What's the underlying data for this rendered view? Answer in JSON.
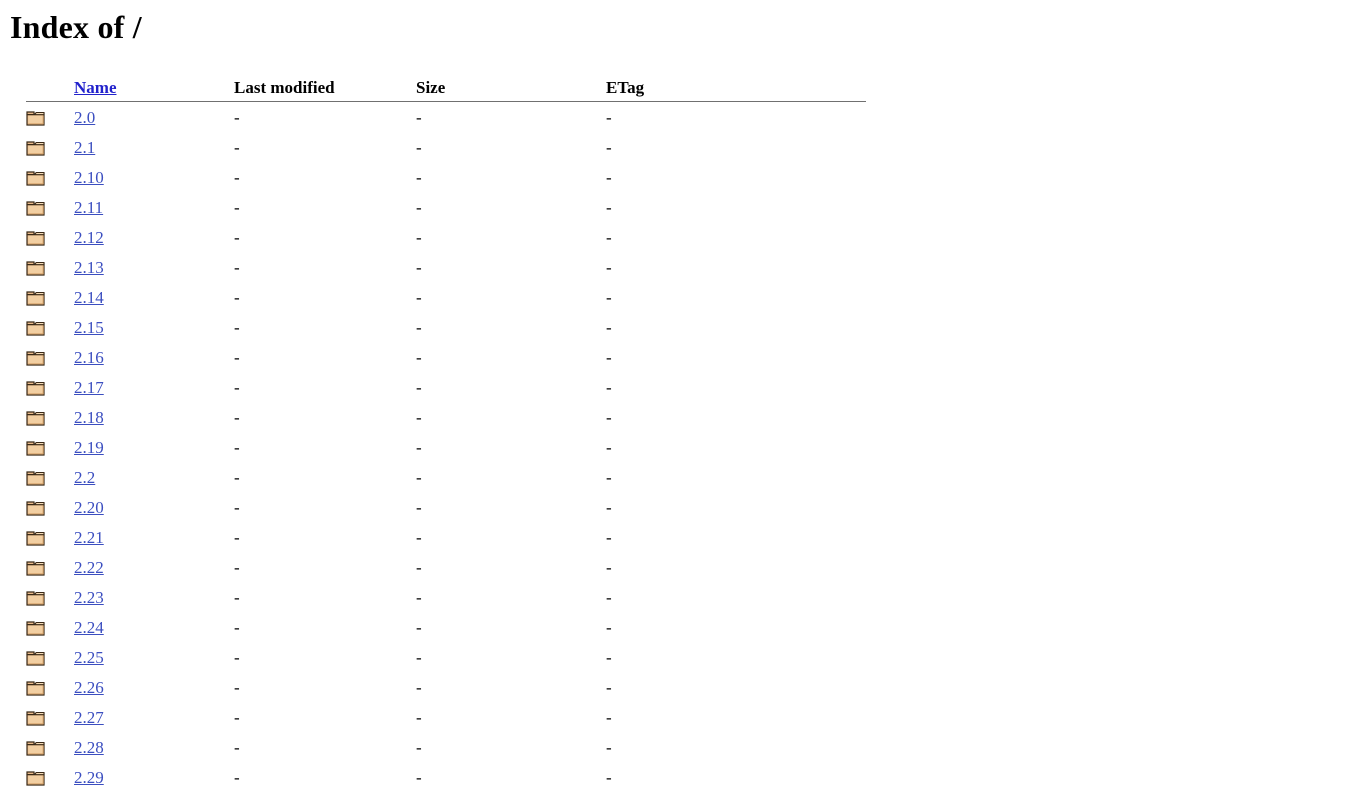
{
  "page": {
    "title": "Index of /"
  },
  "table": {
    "headers": {
      "icon": "",
      "name": "Name",
      "last_modified": "Last modified",
      "size": "Size",
      "etag": "ETag"
    },
    "placeholder_dash": "-",
    "icon_name": "folder-icon",
    "rows": [
      {
        "name": "2.0",
        "last_modified": "-",
        "size": "-",
        "etag": "-"
      },
      {
        "name": "2.1",
        "last_modified": "-",
        "size": "-",
        "etag": "-"
      },
      {
        "name": "2.10",
        "last_modified": "-",
        "size": "-",
        "etag": "-"
      },
      {
        "name": "2.11",
        "last_modified": "-",
        "size": "-",
        "etag": "-"
      },
      {
        "name": "2.12",
        "last_modified": "-",
        "size": "-",
        "etag": "-"
      },
      {
        "name": "2.13",
        "last_modified": "-",
        "size": "-",
        "etag": "-"
      },
      {
        "name": "2.14",
        "last_modified": "-",
        "size": "-",
        "etag": "-"
      },
      {
        "name": "2.15",
        "last_modified": "-",
        "size": "-",
        "etag": "-"
      },
      {
        "name": "2.16",
        "last_modified": "-",
        "size": "-",
        "etag": "-"
      },
      {
        "name": "2.17",
        "last_modified": "-",
        "size": "-",
        "etag": "-"
      },
      {
        "name": "2.18",
        "last_modified": "-",
        "size": "-",
        "etag": "-"
      },
      {
        "name": "2.19",
        "last_modified": "-",
        "size": "-",
        "etag": "-"
      },
      {
        "name": "2.2",
        "last_modified": "-",
        "size": "-",
        "etag": "-"
      },
      {
        "name": "2.20",
        "last_modified": "-",
        "size": "-",
        "etag": "-"
      },
      {
        "name": "2.21",
        "last_modified": "-",
        "size": "-",
        "etag": "-"
      },
      {
        "name": "2.22",
        "last_modified": "-",
        "size": "-",
        "etag": "-"
      },
      {
        "name": "2.23",
        "last_modified": "-",
        "size": "-",
        "etag": "-"
      },
      {
        "name": "2.24",
        "last_modified": "-",
        "size": "-",
        "etag": "-"
      },
      {
        "name": "2.25",
        "last_modified": "-",
        "size": "-",
        "etag": "-"
      },
      {
        "name": "2.26",
        "last_modified": "-",
        "size": "-",
        "etag": "-"
      },
      {
        "name": "2.27",
        "last_modified": "-",
        "size": "-",
        "etag": "-"
      },
      {
        "name": "2.28",
        "last_modified": "-",
        "size": "-",
        "etag": "-"
      },
      {
        "name": "2.29",
        "last_modified": "-",
        "size": "-",
        "etag": "-"
      }
    ]
  },
  "colors": {
    "header_link": "#2222cc",
    "row_link": "#3b4ec0",
    "rule": "#707070",
    "text": "#000000",
    "background": "#ffffff",
    "folder_fill": "#f0cda0",
    "folder_shade": "#e0b07a",
    "folder_outline": "#3a2a18"
  }
}
